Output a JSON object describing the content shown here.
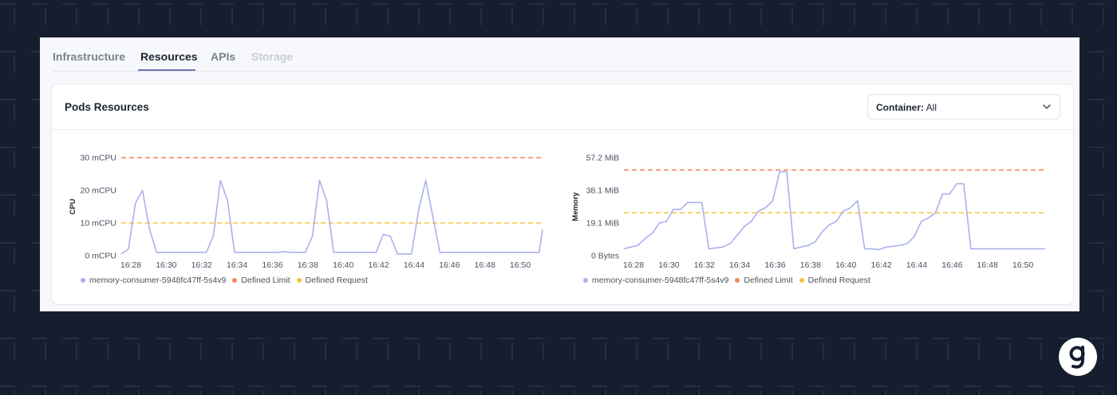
{
  "tabs": [
    {
      "label": "Infrastructure",
      "state": "normal"
    },
    {
      "label": "Resources",
      "state": "active"
    },
    {
      "label": "APIs",
      "state": "normal"
    },
    {
      "label": "Storage",
      "state": "disabled"
    }
  ],
  "card": {
    "title": "Pods Resources",
    "container_select": {
      "label": "Container:",
      "value": "All"
    }
  },
  "colors": {
    "series": "#aab0ee",
    "limit": "#f2895c",
    "request": "#f5c33b",
    "background": "#151d2e"
  },
  "legend": {
    "series": "memory-consumer-5948fc47ff-5s4v9",
    "limit": "Defined Limit",
    "request": "Defined Request"
  },
  "chart_data": [
    {
      "type": "line",
      "title": "",
      "ylabel": "CPU",
      "xlabel": "",
      "x_ticks": [
        "16:28",
        "16:30",
        "16:32",
        "16:34",
        "16:36",
        "16:38",
        "16:40",
        "16:42",
        "16:44",
        "16:46",
        "16:48",
        "16:50"
      ],
      "x_range": [
        16.2,
        40.0
      ],
      "y_ticks": [
        {
          "value": 0,
          "label": "0 mCPU"
        },
        {
          "value": 10,
          "label": "10 mCPU"
        },
        {
          "value": 20,
          "label": "20 mCPU"
        },
        {
          "value": 30,
          "label": "30 mCPU"
        }
      ],
      "ylim": [
        0,
        30
      ],
      "grid": false,
      "legend_position": "bottom-left",
      "thresholds": {
        "limit": 30,
        "request": 10
      },
      "series": [
        {
          "name": "memory-consumer-5948fc47ff-5s4v9",
          "x": [
            16.2,
            16.6,
            17.0,
            17.4,
            17.8,
            18.2,
            18.6,
            19.0,
            19.4,
            19.8,
            20.2,
            20.6,
            21.0,
            21.4,
            21.8,
            22.2,
            22.6,
            23.0,
            23.4,
            23.8,
            24.2,
            24.6,
            25.0,
            25.4,
            25.8,
            26.2,
            26.6,
            27.0,
            27.4,
            27.8,
            28.2,
            28.6,
            29.0,
            29.4,
            29.8,
            30.2,
            30.6,
            31.0,
            31.4,
            31.8,
            32.2,
            32.6,
            33.0,
            33.4,
            33.8,
            34.2,
            34.6,
            35.0,
            35.4,
            35.8,
            36.2,
            36.6,
            37.0,
            37.4,
            37.8,
            38.2,
            38.6,
            39.0,
            39.4,
            39.8,
            40.0
          ],
          "values": [
            0.5,
            2,
            16,
            20,
            8,
            1,
            1,
            1,
            1,
            1,
            1,
            1,
            1,
            6,
            23,
            17,
            1,
            1,
            1,
            1,
            1,
            1,
            1,
            1.2,
            1,
            1,
            1,
            6,
            23,
            17,
            1,
            1,
            1,
            1,
            1,
            1,
            1,
            6.5,
            6,
            0.5,
            0.5,
            0.5,
            14,
            23,
            12,
            1,
            1,
            1,
            1,
            1,
            1,
            1,
            1,
            1,
            1,
            1,
            1,
            1,
            1,
            1,
            8
          ]
        }
      ]
    },
    {
      "type": "line",
      "title": "",
      "ylabel": "Memory",
      "xlabel": "",
      "x_ticks": [
        "16:28",
        "16:30",
        "16:32",
        "16:34",
        "16:36",
        "16:38",
        "16:40",
        "16:42",
        "16:44",
        "16:46",
        "16:48",
        "16:50"
      ],
      "x_range": [
        16.2,
        40.0
      ],
      "y_ticks": [
        {
          "value": 0,
          "label": "0 Bytes"
        },
        {
          "value": 19.1,
          "label": "19.1 MiB"
        },
        {
          "value": 38.1,
          "label": "38.1 MiB"
        },
        {
          "value": 57.2,
          "label": "57.2 MiB"
        }
      ],
      "ylim": [
        0,
        57.2
      ],
      "grid": false,
      "legend_position": "bottom-left",
      "thresholds": {
        "limit": 50,
        "request": 25
      },
      "series": [
        {
          "name": "memory-consumer-5948fc47ff-5s4v9",
          "x": [
            16.2,
            16.6,
            17.0,
            17.4,
            17.8,
            18.2,
            18.6,
            19.0,
            19.4,
            19.8,
            20.2,
            20.6,
            21.0,
            21.4,
            21.8,
            22.2,
            22.6,
            23.0,
            23.4,
            23.8,
            24.2,
            24.6,
            25.0,
            25.4,
            25.8,
            26.2,
            26.6,
            27.0,
            27.4,
            27.8,
            28.2,
            28.6,
            29.0,
            29.4,
            29.8,
            30.2,
            30.6,
            31.0,
            31.4,
            31.8,
            32.2,
            32.6,
            33.0,
            33.4,
            33.8,
            34.2,
            34.6,
            35.0,
            35.4,
            35.8,
            36.2,
            36.6,
            37.0,
            37.4,
            37.8,
            38.2,
            38.6,
            39.0,
            39.4,
            39.8,
            40.0
          ],
          "values": [
            4,
            5,
            6,
            10,
            13,
            19,
            20,
            27,
            27,
            31,
            31,
            31,
            4,
            4.5,
            5,
            7,
            12,
            17,
            20,
            26,
            28,
            32,
            49,
            49,
            4,
            5,
            6,
            8,
            14,
            18,
            20,
            26,
            28,
            32,
            4,
            4,
            3.5,
            5,
            5.5,
            6,
            7,
            11,
            20,
            22,
            25,
            36,
            36,
            42,
            42,
            4,
            4,
            4,
            4,
            4,
            4,
            4,
            4,
            4,
            4,
            4,
            4
          ]
        }
      ]
    }
  ]
}
